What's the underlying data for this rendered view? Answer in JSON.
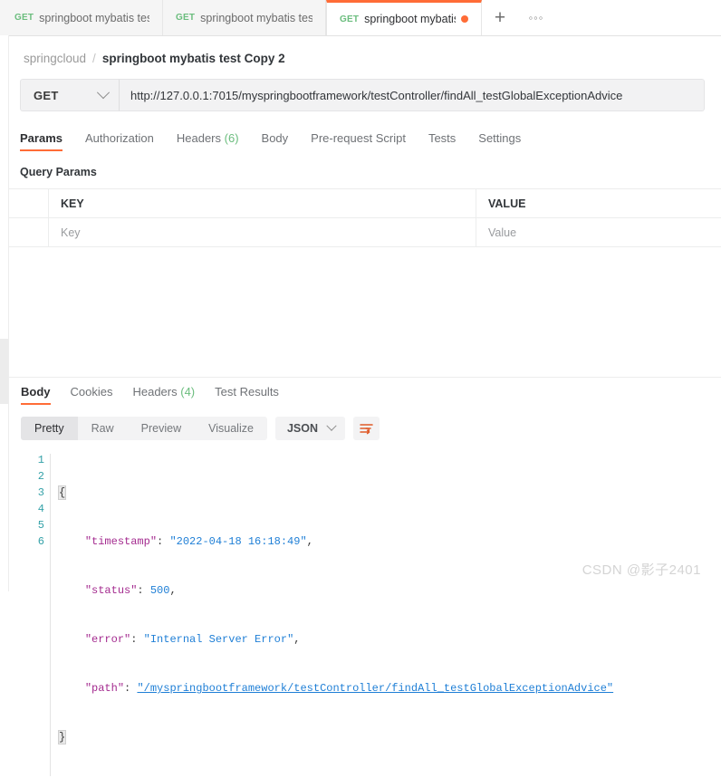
{
  "tabs": [
    {
      "method": "GET",
      "label": "springboot mybatis test",
      "active": false,
      "unsaved": false
    },
    {
      "method": "GET",
      "label": "springboot mybatis test C",
      "active": false,
      "unsaved": false
    },
    {
      "method": "GET",
      "label": "springboot mybatis tes",
      "active": true,
      "unsaved": true
    }
  ],
  "tabbar": {
    "new_tab_label": "+",
    "more_label": "◦◦◦"
  },
  "breadcrumb": {
    "root": "springcloud",
    "separator": "/",
    "current": "springboot mybatis test Copy 2"
  },
  "request": {
    "method": "GET",
    "url": "http://127.0.0.1:7015/myspringbootframework/testController/findAll_testGlobalExceptionAdvice",
    "tabs": [
      {
        "label": "Params",
        "active": true
      },
      {
        "label": "Authorization",
        "active": false
      },
      {
        "label": "Headers",
        "count": "(6)",
        "active": false
      },
      {
        "label": "Body",
        "active": false
      },
      {
        "label": "Pre-request Script",
        "active": false
      },
      {
        "label": "Tests",
        "active": false
      },
      {
        "label": "Settings",
        "active": false
      }
    ]
  },
  "query_params": {
    "title": "Query Params",
    "columns": [
      "KEY",
      "VALUE"
    ],
    "rows": [
      {
        "key_placeholder": "Key",
        "value_placeholder": "Value"
      }
    ]
  },
  "response": {
    "tabs": [
      {
        "label": "Body",
        "active": true
      },
      {
        "label": "Cookies",
        "active": false
      },
      {
        "label": "Headers",
        "count": "(4)",
        "active": false
      },
      {
        "label": "Test Results",
        "active": false
      }
    ],
    "view_modes": [
      {
        "label": "Pretty",
        "active": true
      },
      {
        "label": "Raw",
        "active": false
      },
      {
        "label": "Preview",
        "active": false
      },
      {
        "label": "Visualize",
        "active": false
      }
    ],
    "format": "JSON",
    "wrap_icon": "wrap-text-icon",
    "body_lines": [
      {
        "n": "1",
        "content": "{"
      },
      {
        "n": "2",
        "content": "    \"timestamp\": \"2022-04-18 16:18:49\","
      },
      {
        "n": "3",
        "content": "    \"status\": 500,"
      },
      {
        "n": "4",
        "content": "    \"error\": \"Internal Server Error\","
      },
      {
        "n": "5",
        "content": "    \"path\": \"/myspringbootframework/testController/findAll_testGlobalExceptionAdvice\""
      },
      {
        "n": "6",
        "content": "}"
      }
    ],
    "body_json": {
      "timestamp": "2022-04-18 16:18:49",
      "status": 500,
      "error": "Internal Server Error",
      "path": "/myspringbootframework/testController/findAll_testGlobalExceptionAdvice"
    }
  },
  "watermark": "CSDN @影子2401",
  "colors": {
    "accent": "#ff6c37",
    "method_get": "#6bbd7e",
    "json_string": "#1f7fd6",
    "json_key": "#a42b8f",
    "gutter": "#34a1a8"
  }
}
